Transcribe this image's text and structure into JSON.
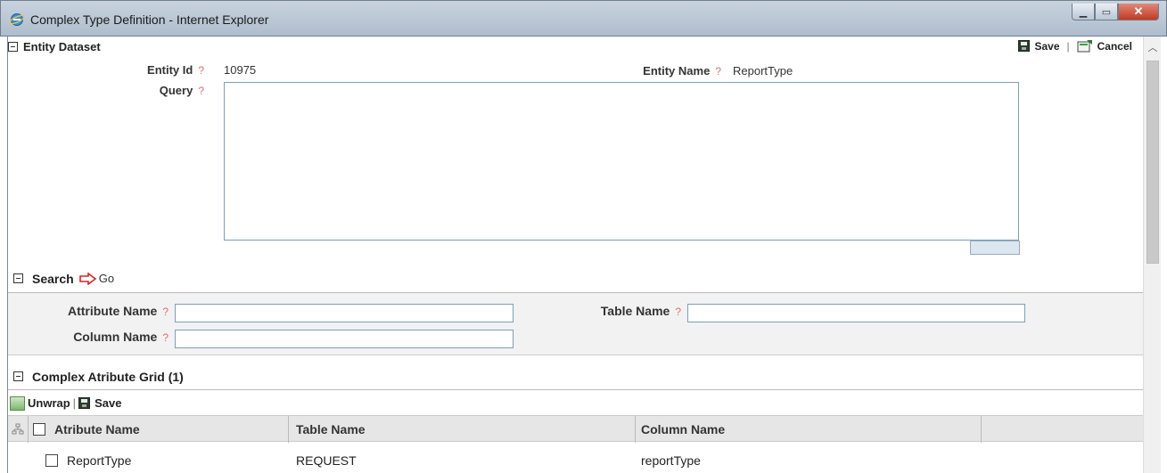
{
  "window": {
    "title": "Complex Type Definition - Internet Explorer",
    "minimize_icon": "minimize-icon",
    "maximize_icon": "maximize-icon",
    "close_icon": "close-icon",
    "close_label": "✕"
  },
  "entity_dataset": {
    "title": "Entity Dataset",
    "save_label": "Save",
    "cancel_label": "Cancel",
    "entity_id_label": "Entity Id",
    "entity_id_value": "10975",
    "entity_name_label": "Entity Name",
    "entity_name_value": "ReportType",
    "query_label": "Query",
    "query_value": "",
    "help_mark": "?"
  },
  "search": {
    "title": "Search",
    "go_label": "Go",
    "attribute_name_label": "Attribute Name",
    "attribute_name_value": "",
    "table_name_label": "Table Name",
    "table_name_value": "",
    "column_name_label": "Column Name",
    "column_name_value": ""
  },
  "grid": {
    "title": "Complex Atribute Grid",
    "count": "(1)",
    "unwrap_label": "Unwrap",
    "save_label": "Save",
    "columns": [
      "Atribute Name",
      "Table Name",
      "Column Name"
    ],
    "rows": [
      {
        "attribute_name": "ReportType",
        "table_name": "REQUEST",
        "column_name": "reportType"
      }
    ]
  },
  "colors": {
    "accent_help": "#e07070",
    "go_arrow": "#e02020",
    "panel_bg": "#f2f2f2",
    "grid_header_bg": "#e6e6e6"
  }
}
